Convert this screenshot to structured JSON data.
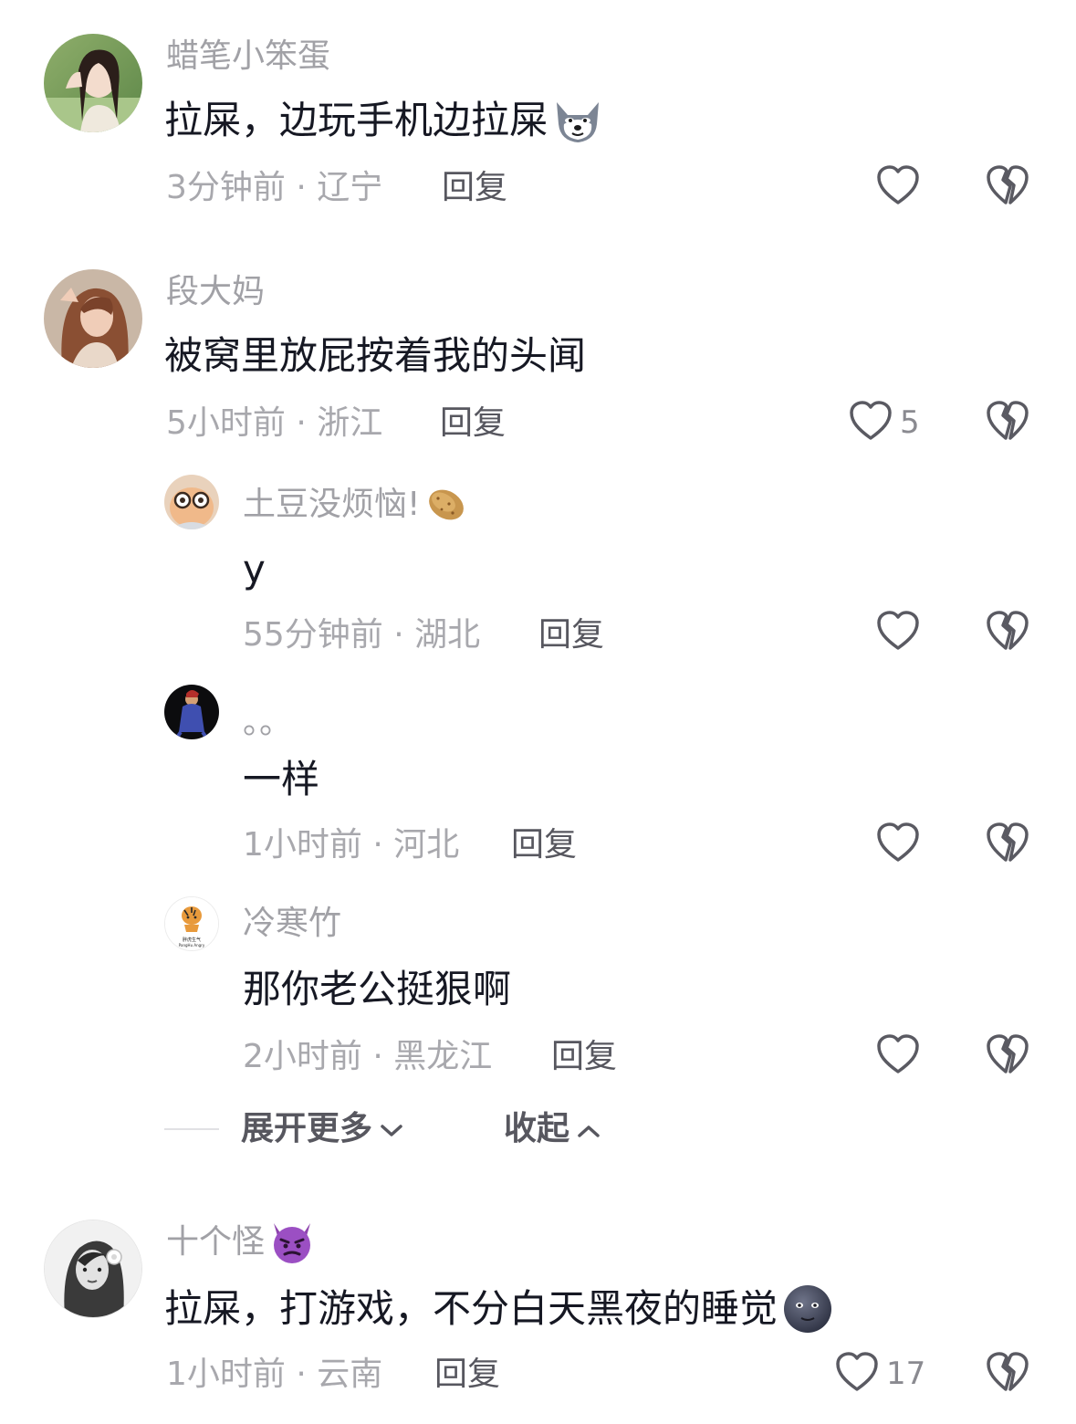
{
  "comments": [
    {
      "username": "蜡笔小笨蛋",
      "text": "拉屎，边玩手机边拉屎",
      "emoji": "wolf-emoji",
      "time": "3分钟前",
      "location": "辽宁",
      "meta": "3分钟前 · 辽宁",
      "reply_label": "回复",
      "likes": ""
    },
    {
      "username": "段大妈",
      "text": "被窝里放屁按着我的头闻",
      "time": "5小时前",
      "location": "浙江",
      "meta": "5小时前 · 浙江",
      "reply_label": "回复",
      "likes": "5",
      "replies": [
        {
          "username": "土豆没烦恼!",
          "emoji": "potato-emoji",
          "text": "y",
          "meta": "55分钟前 · 湖北",
          "reply_label": "回复",
          "likes": ""
        },
        {
          "username": "。。",
          "text": "一样",
          "meta": "1小时前 · 河北",
          "reply_label": "回复",
          "likes": ""
        },
        {
          "username": "冷寒竹",
          "text": "那你老公挺狠啊",
          "meta": "2小时前 · 黑龙江",
          "reply_label": "回复",
          "likes": "",
          "avatar_caption": "胖虎生气 PangHu Angry"
        }
      ],
      "expand_label": "展开更多",
      "collapse_label": "收起"
    },
    {
      "username": "十个怪",
      "emoji": "smiling-devil-emoji",
      "text": "拉屎，打游戏，不分白天黑夜的睡觉",
      "text_emoji": "new-moon-face-emoji",
      "meta": "1小时前 · 云南",
      "reply_label": "回复",
      "likes": "17"
    }
  ],
  "colors": {
    "text_primary": "#161823",
    "text_secondary": "#a1a1a6",
    "icon": "#5a5a62"
  }
}
